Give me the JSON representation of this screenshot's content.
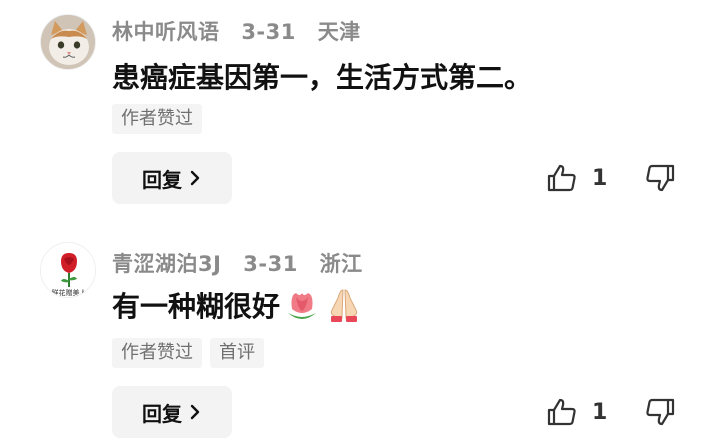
{
  "comments": [
    {
      "username": "林中听风语",
      "date": "3-31",
      "location": "天津",
      "text": "患癌症基因第一，生活方式第二。",
      "tags": [
        "作者赞过"
      ],
      "reply_label": "回复",
      "like_count": "1",
      "avatar": "cat-avatar"
    },
    {
      "username": "青涩湖泊3J",
      "date": "3-31",
      "location": "浙江",
      "text": "有一种糊很好",
      "tags": [
        "作者赞过",
        "首评"
      ],
      "reply_label": "回复",
      "like_count": "1",
      "avatar": "rose-avatar",
      "avatar_text": "鲜花赠美人",
      "emojis": [
        "tulip-emoji",
        "folded-hands-emoji"
      ]
    }
  ],
  "colors": {
    "meta": "#8a8a8a",
    "tag_bg": "#f4f4f4",
    "button_bg": "#f3f3f3",
    "text": "#111111"
  }
}
